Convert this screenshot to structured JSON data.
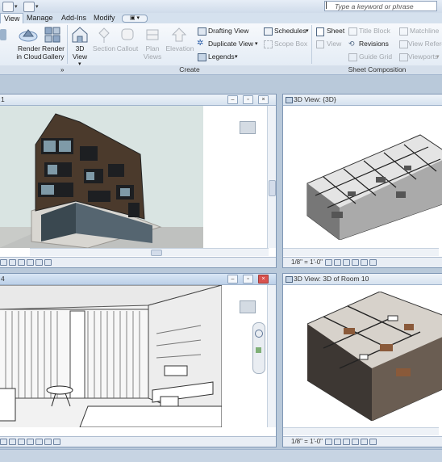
{
  "titlebar": {
    "search_placeholder": "Type a keyword or phrase"
  },
  "tabs": [
    {
      "label": "View"
    },
    {
      "label": "Manage"
    },
    {
      "label": "Add-Ins"
    },
    {
      "label": "Modify"
    }
  ],
  "ribbon": {
    "render_cloud": "Render in Cloud",
    "render_gallery": "Render Gallery",
    "view_3d": "3D View",
    "section": "Section",
    "callout": "Callout",
    "plan_views": "Plan Views",
    "elevation": "Elevation",
    "drafting_view": "Drafting View",
    "duplicate_view": "Duplicate View",
    "legends": "Legends",
    "schedules": "Schedules",
    "scope_box": "Scope Box",
    "sheet": "Sheet",
    "title_block": "Title Block",
    "matchline": "Matchline",
    "view": "View",
    "revisions": "Revisions",
    "view_reference": "View Reference",
    "guide_grid": "Guide Grid",
    "viewports": "Viewports",
    "panel_create": "Create",
    "panel_sheet": "Sheet Composition"
  },
  "views": {
    "top_right_title": "3D View: {3D}",
    "bottom_right_title": "3D View: 3D of Room 10",
    "top_left_title": "1",
    "bottom_left_title": "4",
    "scale": "1/8\" = 1'-0\""
  },
  "colors": {
    "accent": "#2a5ea8",
    "frame": "#b9c9da",
    "close": "#d9534f"
  }
}
